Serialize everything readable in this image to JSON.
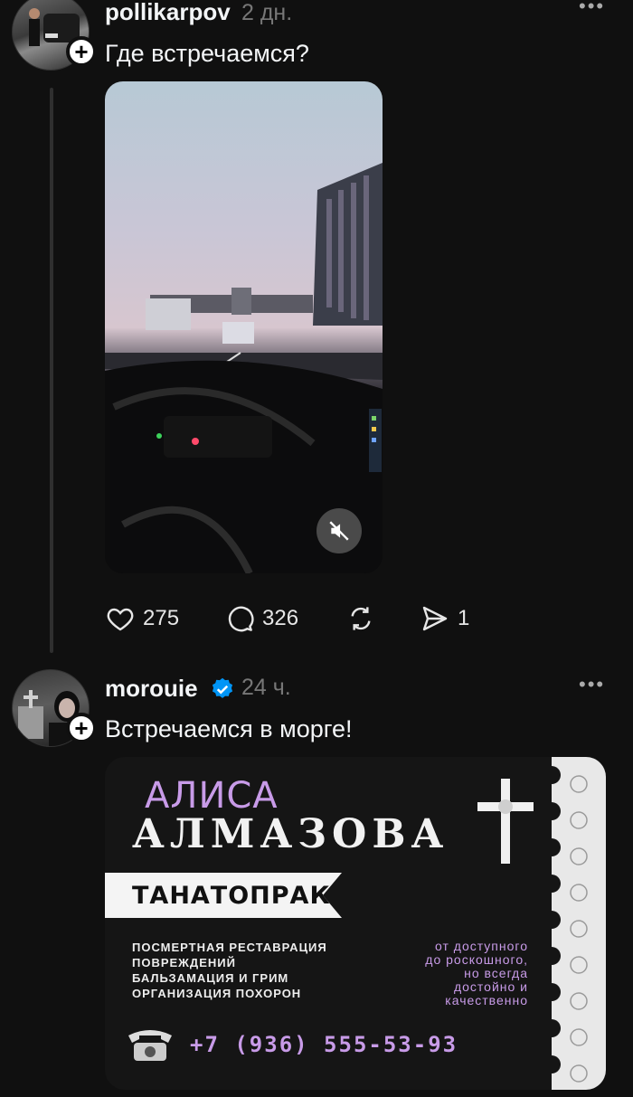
{
  "posts": [
    {
      "username": "pollikarpov",
      "time": "2 дн.",
      "text": "Где встречаемся?",
      "likes": "275",
      "comments": "326",
      "shares": "1"
    },
    {
      "username": "morouie",
      "verified": true,
      "time": "24 ч.",
      "text": "Встречаемся в морге!",
      "card": {
        "name_first": "АЛИСА",
        "name_last": "АЛМАЗОВА",
        "title": "ТАНАТОПРАКТИК",
        "services": [
          "ПОСМЕРТНАЯ РЕСТАВРАЦИЯ",
          "ПОВРЕЖДЕНИЙ",
          "БАЛЬЗАМАЦИЯ И ГРИМ",
          "ОРГАНИЗАЦИЯ ПОХОРОН"
        ],
        "slogan": [
          "от доступного",
          "до роскошного,",
          "но всегда",
          "достойно и",
          "качественно"
        ],
        "phone": "+7 (936) 555-53-93"
      }
    }
  ],
  "colors": {
    "background": "#101010",
    "accent_purple": "#c89be8",
    "verified_blue": "#0095f6"
  },
  "icons": {
    "like": "heart-icon",
    "comment": "comment-icon",
    "repost": "repost-icon",
    "share": "send-icon",
    "mute": "muted-speaker-icon",
    "follow": "plus-icon",
    "more": "more-dots-icon"
  }
}
